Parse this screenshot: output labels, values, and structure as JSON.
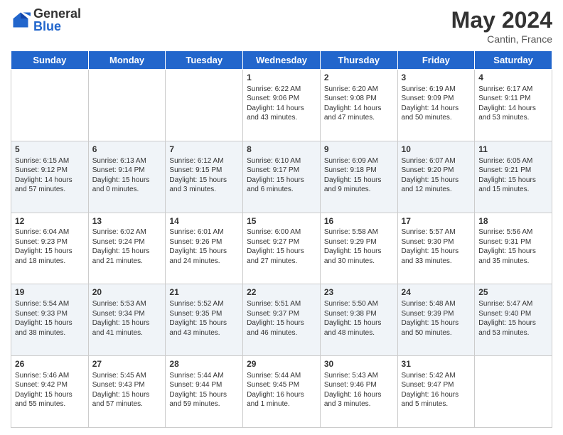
{
  "header": {
    "logo_general": "General",
    "logo_blue": "Blue",
    "month_title": "May 2024",
    "location": "Cantin, France"
  },
  "days_of_week": [
    "Sunday",
    "Monday",
    "Tuesday",
    "Wednesday",
    "Thursday",
    "Friday",
    "Saturday"
  ],
  "weeks": [
    [
      {
        "day": "",
        "info": ""
      },
      {
        "day": "",
        "info": ""
      },
      {
        "day": "",
        "info": ""
      },
      {
        "day": "1",
        "info": "Sunrise: 6:22 AM\nSunset: 9:06 PM\nDaylight: 14 hours\nand 43 minutes."
      },
      {
        "day": "2",
        "info": "Sunrise: 6:20 AM\nSunset: 9:08 PM\nDaylight: 14 hours\nand 47 minutes."
      },
      {
        "day": "3",
        "info": "Sunrise: 6:19 AM\nSunset: 9:09 PM\nDaylight: 14 hours\nand 50 minutes."
      },
      {
        "day": "4",
        "info": "Sunrise: 6:17 AM\nSunset: 9:11 PM\nDaylight: 14 hours\nand 53 minutes."
      }
    ],
    [
      {
        "day": "5",
        "info": "Sunrise: 6:15 AM\nSunset: 9:12 PM\nDaylight: 14 hours\nand 57 minutes."
      },
      {
        "day": "6",
        "info": "Sunrise: 6:13 AM\nSunset: 9:14 PM\nDaylight: 15 hours\nand 0 minutes."
      },
      {
        "day": "7",
        "info": "Sunrise: 6:12 AM\nSunset: 9:15 PM\nDaylight: 15 hours\nand 3 minutes."
      },
      {
        "day": "8",
        "info": "Sunrise: 6:10 AM\nSunset: 9:17 PM\nDaylight: 15 hours\nand 6 minutes."
      },
      {
        "day": "9",
        "info": "Sunrise: 6:09 AM\nSunset: 9:18 PM\nDaylight: 15 hours\nand 9 minutes."
      },
      {
        "day": "10",
        "info": "Sunrise: 6:07 AM\nSunset: 9:20 PM\nDaylight: 15 hours\nand 12 minutes."
      },
      {
        "day": "11",
        "info": "Sunrise: 6:05 AM\nSunset: 9:21 PM\nDaylight: 15 hours\nand 15 minutes."
      }
    ],
    [
      {
        "day": "12",
        "info": "Sunrise: 6:04 AM\nSunset: 9:23 PM\nDaylight: 15 hours\nand 18 minutes."
      },
      {
        "day": "13",
        "info": "Sunrise: 6:02 AM\nSunset: 9:24 PM\nDaylight: 15 hours\nand 21 minutes."
      },
      {
        "day": "14",
        "info": "Sunrise: 6:01 AM\nSunset: 9:26 PM\nDaylight: 15 hours\nand 24 minutes."
      },
      {
        "day": "15",
        "info": "Sunrise: 6:00 AM\nSunset: 9:27 PM\nDaylight: 15 hours\nand 27 minutes."
      },
      {
        "day": "16",
        "info": "Sunrise: 5:58 AM\nSunset: 9:29 PM\nDaylight: 15 hours\nand 30 minutes."
      },
      {
        "day": "17",
        "info": "Sunrise: 5:57 AM\nSunset: 9:30 PM\nDaylight: 15 hours\nand 33 minutes."
      },
      {
        "day": "18",
        "info": "Sunrise: 5:56 AM\nSunset: 9:31 PM\nDaylight: 15 hours\nand 35 minutes."
      }
    ],
    [
      {
        "day": "19",
        "info": "Sunrise: 5:54 AM\nSunset: 9:33 PM\nDaylight: 15 hours\nand 38 minutes."
      },
      {
        "day": "20",
        "info": "Sunrise: 5:53 AM\nSunset: 9:34 PM\nDaylight: 15 hours\nand 41 minutes."
      },
      {
        "day": "21",
        "info": "Sunrise: 5:52 AM\nSunset: 9:35 PM\nDaylight: 15 hours\nand 43 minutes."
      },
      {
        "day": "22",
        "info": "Sunrise: 5:51 AM\nSunset: 9:37 PM\nDaylight: 15 hours\nand 46 minutes."
      },
      {
        "day": "23",
        "info": "Sunrise: 5:50 AM\nSunset: 9:38 PM\nDaylight: 15 hours\nand 48 minutes."
      },
      {
        "day": "24",
        "info": "Sunrise: 5:48 AM\nSunset: 9:39 PM\nDaylight: 15 hours\nand 50 minutes."
      },
      {
        "day": "25",
        "info": "Sunrise: 5:47 AM\nSunset: 9:40 PM\nDaylight: 15 hours\nand 53 minutes."
      }
    ],
    [
      {
        "day": "26",
        "info": "Sunrise: 5:46 AM\nSunset: 9:42 PM\nDaylight: 15 hours\nand 55 minutes."
      },
      {
        "day": "27",
        "info": "Sunrise: 5:45 AM\nSunset: 9:43 PM\nDaylight: 15 hours\nand 57 minutes."
      },
      {
        "day": "28",
        "info": "Sunrise: 5:44 AM\nSunset: 9:44 PM\nDaylight: 15 hours\nand 59 minutes."
      },
      {
        "day": "29",
        "info": "Sunrise: 5:44 AM\nSunset: 9:45 PM\nDaylight: 16 hours\nand 1 minute."
      },
      {
        "day": "30",
        "info": "Sunrise: 5:43 AM\nSunset: 9:46 PM\nDaylight: 16 hours\nand 3 minutes."
      },
      {
        "day": "31",
        "info": "Sunrise: 5:42 AM\nSunset: 9:47 PM\nDaylight: 16 hours\nand 5 minutes."
      },
      {
        "day": "",
        "info": ""
      }
    ]
  ]
}
